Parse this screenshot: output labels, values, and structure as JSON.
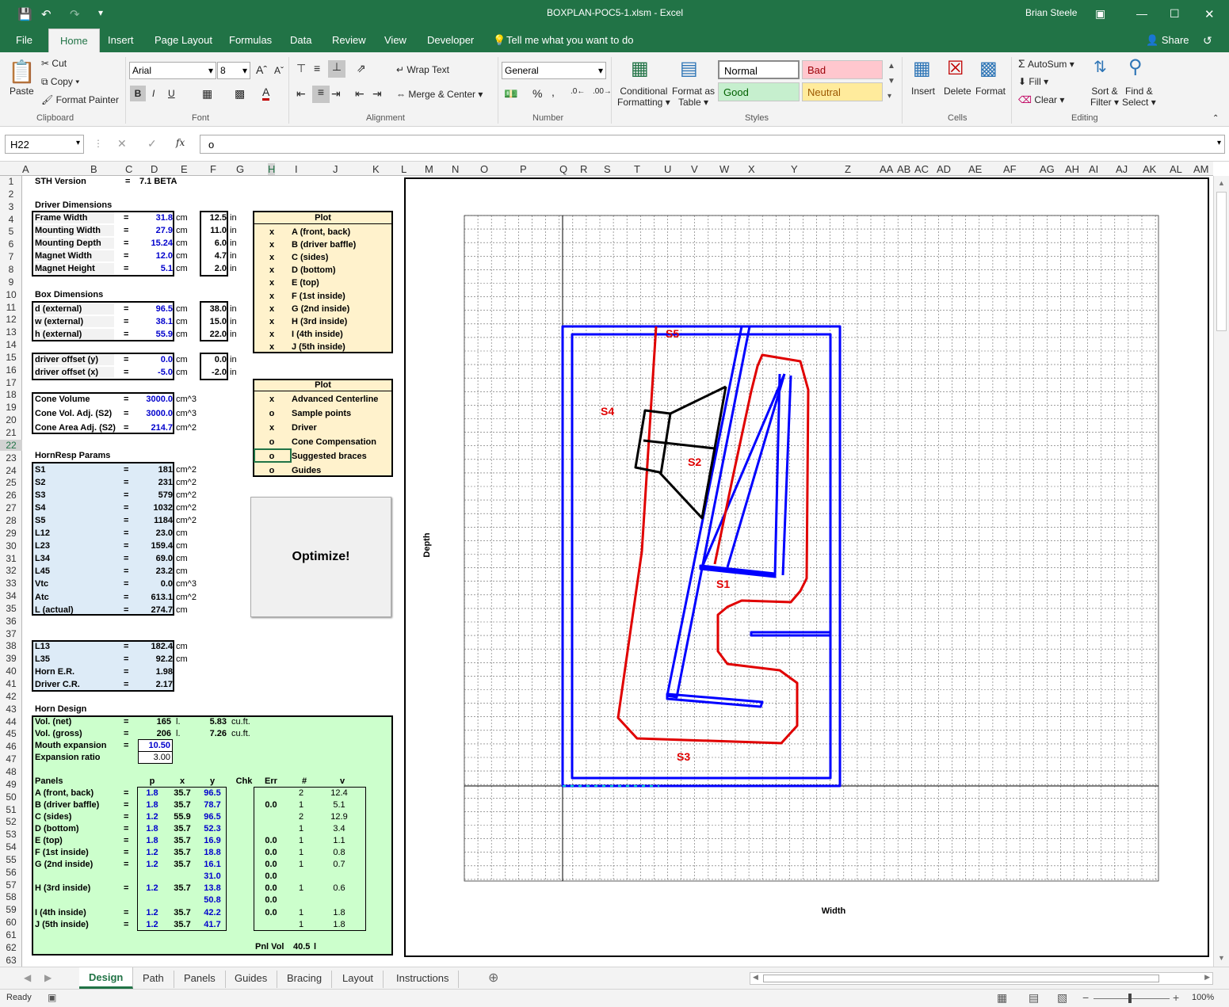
{
  "window": {
    "title": "BOXPLAN-POC5-1.xlsm  -  Excel",
    "user": "Brian Steele",
    "share": "Share"
  },
  "tabs": [
    "File",
    "Home",
    "Insert",
    "Page Layout",
    "Formulas",
    "Data",
    "Review",
    "View",
    "Developer"
  ],
  "tellme": "Tell me what you want to do",
  "ribbon": {
    "clipboard": {
      "paste": "Paste",
      "cut": "Cut",
      "copy": "Copy",
      "painter": "Format Painter",
      "label": "Clipboard"
    },
    "font": {
      "name": "Arial",
      "size": "8",
      "label": "Font",
      "bold": "B",
      "italic": "I",
      "underline": "U"
    },
    "alignment": {
      "wrap": "Wrap Text",
      "merge": "Merge & Center",
      "label": "Alignment"
    },
    "number": {
      "format": "General",
      "label": "Number",
      "pct": "%",
      "comma": ","
    },
    "styles": {
      "cond1": "Conditional",
      "cond2": "Formatting",
      "fmt1": "Format as",
      "fmt2": "Table",
      "normal": "Normal",
      "bad": "Bad",
      "good": "Good",
      "neutral": "Neutral",
      "label": "Styles"
    },
    "cells": {
      "insert": "Insert",
      "delete": "Delete",
      "format": "Format",
      "label": "Cells"
    },
    "editing": {
      "autosum": "AutoSum",
      "fill": "Fill",
      "clear": "Clear",
      "sort1": "Sort &",
      "sort2": "Filter",
      "find1": "Find &",
      "find2": "Select",
      "label": "Editing"
    }
  },
  "formula": {
    "namebox": "H22",
    "value": "o"
  },
  "columns": [
    "A",
    "B",
    "C",
    "D",
    "E",
    "F",
    "G",
    "H",
    "I",
    "J",
    "K",
    "L",
    "M",
    "N",
    "O",
    "P",
    "Q",
    "R",
    "S",
    "T",
    "U",
    "V",
    "W",
    "X",
    "Y",
    "Z",
    "AA",
    "AB",
    "AC",
    "AD",
    "AE",
    "AF",
    "AG",
    "AH",
    "AI",
    "AJ",
    "AK",
    "AL",
    "AM"
  ],
  "sheet": {
    "version_label": "STH Version",
    "version_eq": "=",
    "version": "7.1 BETA",
    "driver_title": "Driver Dimensions",
    "driver": [
      {
        "label": "Frame Width",
        "eq": "=",
        "cm": "31.8",
        "u": "cm",
        "in": "12.5",
        "ui": "in"
      },
      {
        "label": "Mounting Width",
        "eq": "=",
        "cm": "27.9",
        "u": "cm",
        "in": "11.0",
        "ui": "in"
      },
      {
        "label": "Mounting Depth",
        "eq": "=",
        "cm": "15.24",
        "u": "cm",
        "in": "6.0",
        "ui": "in"
      },
      {
        "label": "Magnet Width",
        "eq": "=",
        "cm": "12.0",
        "u": "cm",
        "in": "4.7",
        "ui": "in"
      },
      {
        "label": "Magnet Height",
        "eq": "=",
        "cm": "5.1",
        "u": "cm",
        "in": "2.0",
        "ui": "in"
      }
    ],
    "box_title": "Box Dimensions",
    "box": [
      {
        "label": "d (external)",
        "eq": "=",
        "cm": "96.5",
        "u": "cm",
        "in": "38.0",
        "ui": "in"
      },
      {
        "label": "w (external)",
        "eq": "=",
        "cm": "38.1",
        "u": "cm",
        "in": "15.0",
        "ui": "in"
      },
      {
        "label": "h (external)",
        "eq": "=",
        "cm": "55.9",
        "u": "cm",
        "in": "22.0",
        "ui": "in"
      }
    ],
    "offset": [
      {
        "label": "driver offset (y)",
        "eq": "=",
        "cm": "0.0",
        "u": "cm",
        "in": "0.0",
        "ui": "in"
      },
      {
        "label": "driver offset (x)",
        "eq": "=",
        "cm": "-5.0",
        "u": "cm",
        "in": "-2.0",
        "ui": "in"
      }
    ],
    "cone": [
      {
        "label": "Cone Volume",
        "eq": "=",
        "v": "3000.0",
        "u": "cm^3"
      },
      {
        "label": "Cone Vol. Adj. (S2)",
        "eq": "=",
        "v": "3000.0",
        "u": "cm^3"
      },
      {
        "label": "Cone Area Adj. (S2)",
        "eq": "=",
        "v": "214.7",
        "u": "cm^2"
      }
    ],
    "hr_title": "HornResp Params",
    "hr": [
      {
        "label": "S1",
        "eq": "=",
        "v": "181",
        "u": "cm^2"
      },
      {
        "label": "S2",
        "eq": "=",
        "v": "231",
        "u": "cm^2"
      },
      {
        "label": "S3",
        "eq": "=",
        "v": "579",
        "u": "cm^2"
      },
      {
        "label": "S4",
        "eq": "=",
        "v": "1032",
        "u": "cm^2"
      },
      {
        "label": "S5",
        "eq": "=",
        "v": "1184",
        "u": "cm^2"
      },
      {
        "label": "L12",
        "eq": "=",
        "v": "23.0",
        "u": "cm"
      },
      {
        "label": "L23",
        "eq": "=",
        "v": "159.4",
        "u": "cm"
      },
      {
        "label": "L34",
        "eq": "=",
        "v": "69.0",
        "u": "cm"
      },
      {
        "label": "L45",
        "eq": "=",
        "v": "23.2",
        "u": "cm"
      },
      {
        "label": "Vtc",
        "eq": "=",
        "v": "0.0",
        "u": "cm^3"
      },
      {
        "label": "Atc",
        "eq": "=",
        "v": "613.1",
        "u": "cm^2"
      },
      {
        "label": "L (actual)",
        "eq": "=",
        "v": "274.7",
        "u": "cm"
      }
    ],
    "lens": [
      {
        "label": "L13",
        "eq": "=",
        "v": "182.4",
        "u": "cm"
      },
      {
        "label": "L35",
        "eq": "=",
        "v": "92.2",
        "u": "cm"
      },
      {
        "label": "Horn E.R.",
        "eq": "=",
        "v": "1.98",
        "u": ""
      },
      {
        "label": "Driver C.R.",
        "eq": "=",
        "v": "2.17",
        "u": ""
      }
    ],
    "plot1": {
      "title": "Plot",
      "items": [
        {
          "m": "x",
          "t": "A (front, back)"
        },
        {
          "m": "x",
          "t": "B (driver baffle)"
        },
        {
          "m": "x",
          "t": "C (sides)"
        },
        {
          "m": "x",
          "t": "D (bottom)"
        },
        {
          "m": "x",
          "t": "E (top)"
        },
        {
          "m": "x",
          "t": "F (1st inside)"
        },
        {
          "m": "x",
          "t": "G (2nd inside)"
        },
        {
          "m": "x",
          "t": "H (3rd inside)"
        },
        {
          "m": "x",
          "t": "I (4th inside)"
        },
        {
          "m": "x",
          "t": "J (5th inside)"
        }
      ]
    },
    "plot2": {
      "title": "Plot",
      "items": [
        {
          "m": "x",
          "t": "Advanced Centerline"
        },
        {
          "m": "o",
          "t": "Sample points"
        },
        {
          "m": "x",
          "t": "Driver"
        },
        {
          "m": "o",
          "t": "Cone Compensation"
        },
        {
          "m": "o",
          "t": "Suggested braces"
        },
        {
          "m": "o",
          "t": "Guides"
        }
      ]
    },
    "optimize": "Optimize!",
    "hd_title": "Horn Design",
    "hd": [
      {
        "label": "Vol. (net)",
        "eq": "=",
        "v": "165",
        "u": "l.",
        "v2": "5.83",
        "u2": "cu.ft."
      },
      {
        "label": "Vol. (gross)",
        "eq": "=",
        "v": "206",
        "u": "l.",
        "v2": "7.26",
        "u2": "cu.ft."
      }
    ],
    "mouth_label": "Mouth expansion",
    "mouth": "10.50",
    "exp_label": "Expansion ratio",
    "exp": "3.00",
    "panels_title": "Panels",
    "panel_cols": [
      "p",
      "x",
      "y",
      "Chk",
      "Err",
      "#",
      "v"
    ],
    "panels": [
      {
        "label": "A (front, back)",
        "eq": "=",
        "p": "1.8",
        "x": "35.7",
        "y": "96.5",
        "err": "",
        "n": "2",
        "v": "12.4"
      },
      {
        "label": "B (driver baffle)",
        "eq": "=",
        "p": "1.8",
        "x": "35.7",
        "y": "78.7",
        "err": "0.0",
        "n": "1",
        "v": "5.1"
      },
      {
        "label": "C (sides)",
        "eq": "=",
        "p": "1.2",
        "x": "55.9",
        "y": "96.5",
        "err": "",
        "n": "2",
        "v": "12.9"
      },
      {
        "label": "D (bottom)",
        "eq": "=",
        "p": "1.8",
        "x": "35.7",
        "y": "52.3",
        "err": "",
        "n": "1",
        "v": "3.4"
      },
      {
        "label": "E (top)",
        "eq": "=",
        "p": "1.8",
        "x": "35.7",
        "y": "16.9",
        "err": "0.0",
        "n": "1",
        "v": "1.1"
      },
      {
        "label": "F (1st inside)",
        "eq": "=",
        "p": "1.2",
        "x": "35.7",
        "y": "18.8",
        "err": "0.0",
        "n": "1",
        "v": "0.8"
      },
      {
        "label": "G (2nd inside)",
        "eq": "=",
        "p": "1.2",
        "x": "35.7",
        "y": "16.1",
        "err": "0.0",
        "n": "1",
        "v": "0.7"
      },
      {
        "label": "",
        "eq": "",
        "p": "",
        "x": "",
        "y": "31.0",
        "err": "0.0",
        "n": "",
        "v": ""
      },
      {
        "label": "H (3rd inside)",
        "eq": "=",
        "p": "1.2",
        "x": "35.7",
        "y": "13.8",
        "err": "0.0",
        "n": "1",
        "v": "0.6"
      },
      {
        "label": "",
        "eq": "",
        "p": "",
        "x": "",
        "y": "50.8",
        "err": "0.0",
        "n": "",
        "v": ""
      },
      {
        "label": "I (4th inside)",
        "eq": "=",
        "p": "1.2",
        "x": "35.7",
        "y": "42.2",
        "err": "0.0",
        "n": "1",
        "v": "1.8"
      },
      {
        "label": "J (5th inside)",
        "eq": "=",
        "p": "1.2",
        "x": "35.7",
        "y": "41.7",
        "err": "",
        "n": "1",
        "v": "1.8"
      }
    ],
    "pnlvol_label": "Pnl Vol",
    "pnlvol": "40.5",
    "pnlvol_u": "l"
  },
  "chart": {
    "xlabel": "Width",
    "ylabel": "Depth",
    "labels": {
      "s1": "S1",
      "s2": "S2",
      "s3": "S3",
      "s4": "S4",
      "s5": "S5"
    },
    "colors": {
      "box": "#0000ff",
      "path": "#ff0000",
      "driver": "#000000"
    }
  },
  "sheettabs": [
    "Design",
    "Path",
    "Panels",
    "Guides",
    "Bracing",
    "Layout",
    "Instructions"
  ],
  "status": {
    "ready": "Ready",
    "zoom": "100%"
  }
}
